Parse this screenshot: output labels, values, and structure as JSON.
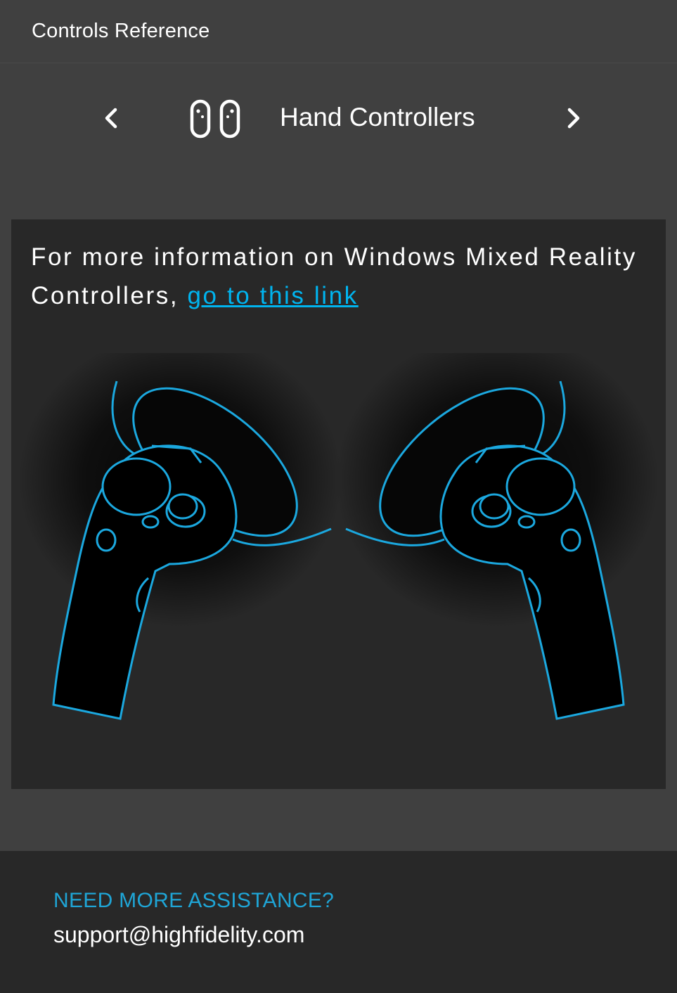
{
  "header": {
    "title": "Controls Reference"
  },
  "device_nav": {
    "prev_icon": "chevron-left-icon",
    "next_icon": "chevron-right-icon",
    "device_icon": "hand-controllers-icon",
    "title": "Hand Controllers"
  },
  "panel": {
    "info_text": "For more information on Windows Mixed Reality Controllers,",
    "link_text": "go to this link",
    "illustration": "windows-mixed-reality-controllers",
    "colors": {
      "outline": "#1ba8df",
      "panel_bg": "#282828"
    }
  },
  "footer": {
    "heading": "NEED MORE ASSISTANCE?",
    "email": "support@highfidelity.com"
  },
  "colors": {
    "background": "#404040",
    "accent": "#00b4ef",
    "footer_bg": "#282828"
  }
}
